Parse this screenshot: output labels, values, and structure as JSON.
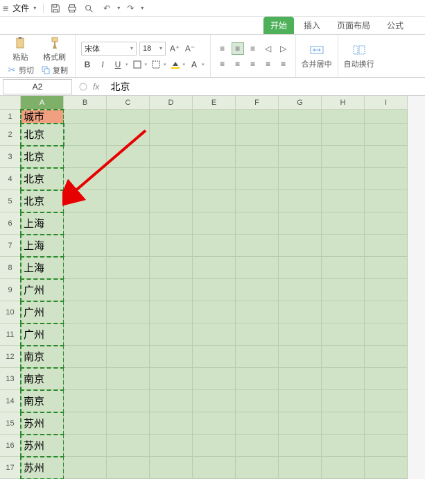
{
  "menu": {
    "file": "文件",
    "icons": {
      "save": "save",
      "print": "print",
      "preview": "preview",
      "undo": "undo",
      "redo": "redo"
    }
  },
  "tabs": {
    "start": "开始",
    "insert": "插入",
    "layout": "页面布局",
    "formula": "公式"
  },
  "ribbon": {
    "cut": "剪切",
    "copy": "复制",
    "paste": "粘贴",
    "painter": "格式刷",
    "font_name": "宋体",
    "font_size": "18",
    "bold": "B",
    "italic": "I",
    "underline": "U",
    "merge": "合并居中",
    "wrap": "自动换行"
  },
  "namebox": "A2",
  "fx": "fx",
  "formula": "北京",
  "columns": [
    "A",
    "B",
    "C",
    "D",
    "E",
    "F",
    "G",
    "H",
    "I"
  ],
  "rows": [
    "1",
    "2",
    "3",
    "4",
    "5",
    "6",
    "7",
    "8",
    "9",
    "10",
    "11",
    "12",
    "13",
    "14",
    "15",
    "16",
    "17"
  ],
  "data": {
    "header": "城市",
    "values": [
      "北京",
      "北京",
      "北京",
      "北京",
      "上海",
      "上海",
      "上海",
      "广州",
      "广州",
      "广州",
      "南京",
      "南京",
      "南京",
      "苏州",
      "苏州",
      "苏州"
    ]
  }
}
